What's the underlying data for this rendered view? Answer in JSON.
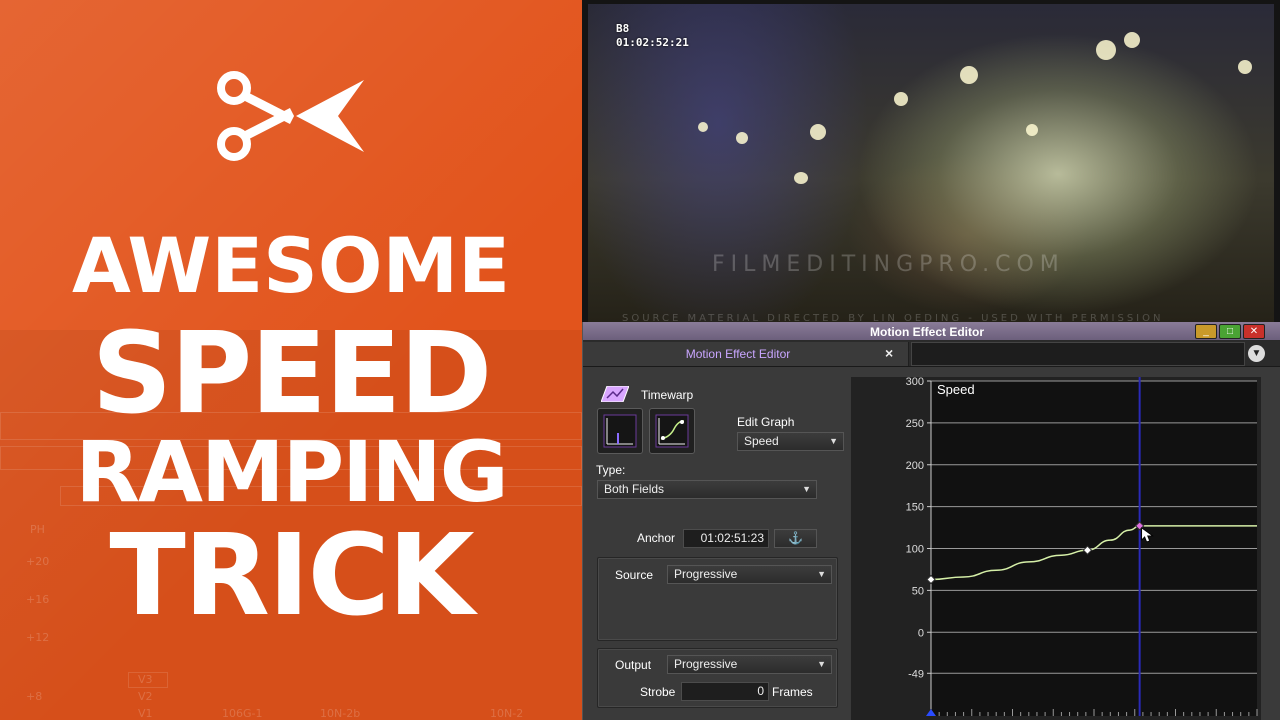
{
  "thumbnail": {
    "title_lines": [
      "AWESOME",
      "SPEED",
      "RAMPING",
      "TRICK"
    ],
    "logo": "scissors-icon",
    "background_color": "#e2541c",
    "ghost_labels": [
      "+20",
      "+16",
      "+12",
      "+8",
      "V3",
      "V2",
      "V1",
      "PH",
      "106G-1",
      "10N-2b",
      "10N-2"
    ]
  },
  "video": {
    "clip_name": "B8",
    "timecode": "01:02:52:21",
    "watermark": "FILMEDITINGPRO.COM",
    "credit": "SOURCE MATERIAL DIRECTED BY LIN OEDING - USED WITH PERMISSION"
  },
  "motion_effect_editor": {
    "window_title": "Motion Effect Editor",
    "tab_label": "Motion Effect Editor",
    "tab_close": "×",
    "window_buttons": {
      "minimize": "_",
      "maximize": "□",
      "close": "✕"
    },
    "timewarp_label": "Timewarp",
    "edit_graph_label": "Edit Graph",
    "edit_graph_value": "Speed",
    "type_label": "Type:",
    "type_value": "Both Fields",
    "anchor_label": "Anchor",
    "anchor_value": "01:02:51:23",
    "source_label": "Source",
    "source_value": "Progressive",
    "output_label": "Output",
    "output_value": "Progressive",
    "strobe_label": "Strobe",
    "strobe_value": "0",
    "strobe_unit": "Frames"
  },
  "chart_data": {
    "type": "line",
    "title": "Speed",
    "xlabel": "",
    "ylabel": "",
    "y_ticks": [
      300,
      250,
      200,
      150,
      100,
      50,
      0,
      -49
    ],
    "ylim": [
      -100,
      300
    ],
    "grid": true,
    "series": [
      {
        "name": "Speed",
        "color": "#d6f0a8",
        "points": [
          [
            0,
            63
          ],
          [
            10,
            66
          ],
          [
            20,
            74
          ],
          [
            30,
            84
          ],
          [
            40,
            92
          ],
          [
            48,
            98
          ],
          [
            55,
            110
          ],
          [
            61,
            122
          ],
          [
            64,
            127
          ],
          [
            72,
            127
          ],
          [
            100,
            127
          ]
        ]
      }
    ],
    "keyframes": [
      [
        0,
        63
      ],
      [
        48,
        98
      ],
      [
        64,
        127
      ]
    ],
    "position_indicator_x": 64
  }
}
